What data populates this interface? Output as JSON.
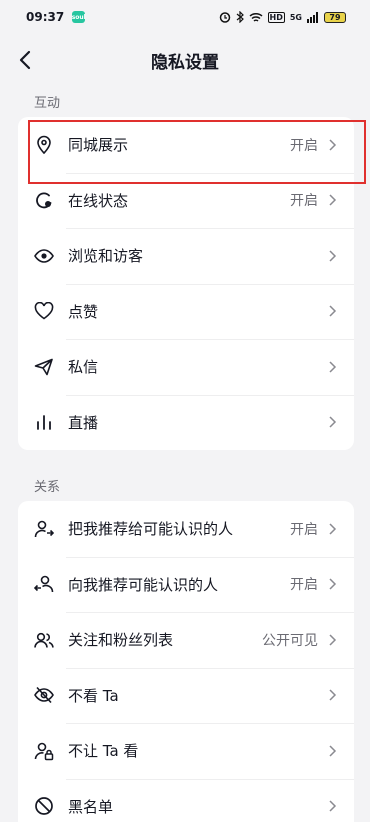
{
  "status_bar": {
    "time": "09:37",
    "app_badge": "soul",
    "battery": "79",
    "network": "5G",
    "hd": "HD"
  },
  "header": {
    "title": "隐私设置"
  },
  "sections": [
    {
      "label": "互动",
      "rows": [
        {
          "label": "同城展示",
          "value": "开启",
          "icon": "location-pin-icon"
        },
        {
          "label": "在线状态",
          "value": "开启",
          "icon": "online-status-icon"
        },
        {
          "label": "浏览和访客",
          "value": "",
          "icon": "eye-icon"
        },
        {
          "label": "点赞",
          "value": "",
          "icon": "heart-icon"
        },
        {
          "label": "私信",
          "value": "",
          "icon": "paper-plane-icon"
        },
        {
          "label": "直播",
          "value": "",
          "icon": "live-bars-icon"
        }
      ]
    },
    {
      "label": "关系",
      "rows": [
        {
          "label": "把我推荐给可能认识的人",
          "value": "开启",
          "icon": "user-share-icon"
        },
        {
          "label": "向我推荐可能认识的人",
          "value": "开启",
          "icon": "user-recommend-icon"
        },
        {
          "label": "关注和粉丝列表",
          "value": "公开可见",
          "icon": "users-icon"
        },
        {
          "label": "不看 Ta",
          "value": "",
          "icon": "eye-off-icon"
        },
        {
          "label": "不让 Ta 看",
          "value": "",
          "icon": "user-lock-icon"
        },
        {
          "label": "黑名单",
          "value": "",
          "icon": "block-icon"
        }
      ]
    }
  ],
  "colors": {
    "background": "#f3f3f5",
    "card": "#ffffff",
    "highlight": "#e0302e"
  }
}
